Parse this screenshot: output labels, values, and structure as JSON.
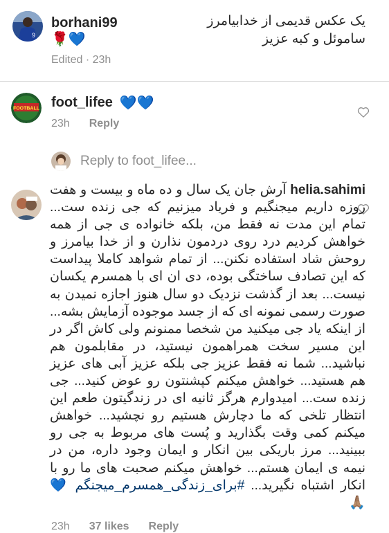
{
  "comments": [
    {
      "username": "borhani99",
      "text": "یک عکس قدیمی از خدابیامرز ساموئل و کبه عزیز",
      "emojis": "🌹💙",
      "time": "Edited · 23h"
    },
    {
      "username": "foot_lifee",
      "emojis": "💙💙",
      "time": "23h",
      "reply_label": "Reply"
    },
    {
      "username": "helia.sahimi",
      "text": "آرش جان یک سال و ده ماه و بیست و هفت روزه داریم میجنگیم و فریاد میزنیم که جی زنده ست... تمام این مدت نه فقط من، بلکه خانواده ی جی از همه خواهش کردیم درد روی دردمون نذارن و از خدا بیامرز و روحش شاد استفاده نکنن... از تمام شواهد کاملا پیداست که این تصادف ساختگی بوده، دی ان ای با همسرم یکسان نیست... بعد از گذشت نزدیک دو سال هنوز اجازه نمیدن به صورت رسمی نمونه ای که از جسد موجوده آزمایش بشه... از اینکه یاد جی میکنید من شخصا ممنونم ولی کاش اگر در این مسیر سخت همراهمون نیستید، در مقابلمون هم نباشید... شما نه فقط عزیز جی بلکه عزیز آبی های عزیز هم هستید... خواهش میکنم کپشنتون رو عوض کنید... جی زنده ست... امیدوارم هرگز ثانیه ای در زندگیتون طعم این انتظار تلخی که ما دچارش هستیم رو نچشید... خواهش میکنم کمی وقت بگذارید و پُست های مربوط به جی رو ببینید... مرز باریکی بین انکار و ایمان وجود داره، من در نیمه ی ایمان هستم... خواهش میکنم صحبت های ما رو با انکار اشتباه نگیرید...",
      "hashtag": "#برای_زندگی_همسرم_میجنگم",
      "emojis": "💙🙏🏽",
      "time": "23h",
      "likes": "37 likes",
      "reply_label": "Reply"
    }
  ],
  "reply_input": {
    "placeholder": "Reply to foot_lifee..."
  },
  "colors": {
    "username": "#262626",
    "meta": "#8e8e8e",
    "hashtag": "#003569",
    "divider": "#dbdbdb",
    "heart_blue": "#3d9bf0"
  },
  "icons": [
    "heart-outline-icon",
    "avatar-image"
  ]
}
